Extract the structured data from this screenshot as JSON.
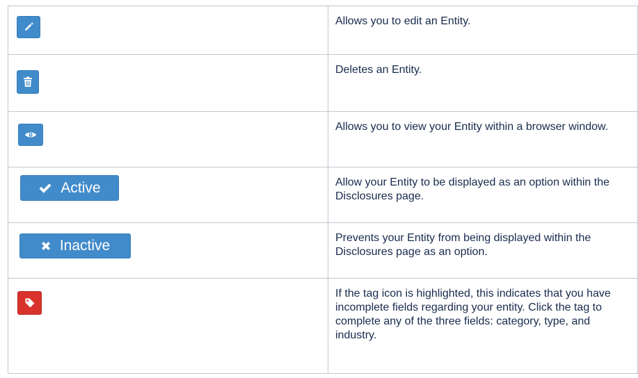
{
  "rows": [
    {
      "icon": "pencil-icon",
      "description": "Allows you to edit an Entity."
    },
    {
      "icon": "trash-icon",
      "description": "Deletes an Entity."
    },
    {
      "icon": "eye-icon",
      "description": "Allows you to view your Entity within a browser window."
    },
    {
      "icon": "check-icon",
      "button_label": "Active",
      "description": "Allow your Entity to be displayed as an option within the Disclosures page."
    },
    {
      "icon": "times-icon",
      "button_label": "Inactive",
      "description": "Prevents your Entity from being displayed within the Disclosures page as an option."
    },
    {
      "icon": "tag-icon",
      "description": "If the tag icon is highlighted, this indicates that you have incomplete fields regarding your entity. Click the tag to complete any of the three fields: category, type, and industry."
    }
  ],
  "colors": {
    "primary_blue": "#428bca",
    "danger_red": "#d9322c",
    "border": "#c1c7d0"
  }
}
